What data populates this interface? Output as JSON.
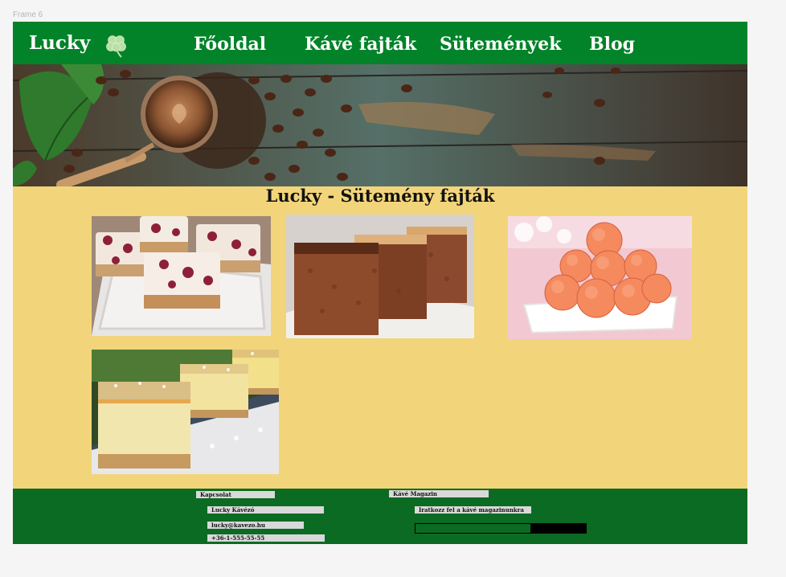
{
  "frame": {
    "label": "Frame 6"
  },
  "nav": {
    "brand": "Lucky",
    "items": [
      "Főoldal",
      "Kávé fajták",
      "Sütemények",
      "Blog"
    ]
  },
  "main": {
    "title": "Lucky - Sütemény fajták"
  },
  "footer": {
    "contact": {
      "heading": "Kapcsolat",
      "name": "Lucky Kávézó",
      "email": "lucky@kavezo.hu",
      "phone": "+36-1-555-55-55"
    },
    "magazine": {
      "heading": "Kávé Magazin",
      "subtitle": "Iratkozz fel a kávé magazinunkra"
    }
  },
  "colors": {
    "nav_bg": "#028329",
    "content_bg": "#f2d57a",
    "footer_bg": "#0b6b23"
  },
  "icons": {
    "brand": "clover-icon"
  }
}
